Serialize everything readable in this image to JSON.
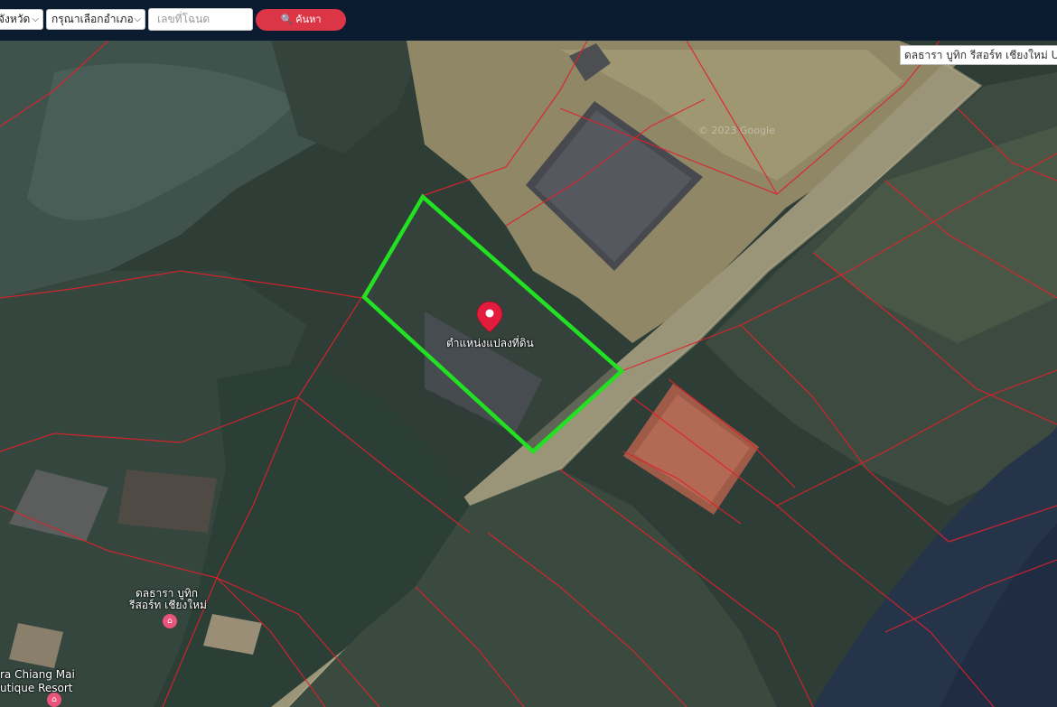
{
  "search": {
    "province_label": "จังหวัด",
    "district_label": "กรุณาเลือกอำเภอ",
    "deed_placeholder": "เลขที่โฉนด",
    "search_label": "ค้นหา"
  },
  "map": {
    "place_name": "ดลธารา บูทิก รีสอร์ท เชียงใหม่ Ur",
    "watermark": "© 2023 Google",
    "parcel_label": "ตำแหน่งแปลงที่ดิน",
    "poi_1_line1": "ดลธารา บูทิก",
    "poi_1_line2": "รีสอร์ท เชียงใหม่",
    "poi_2_line1": "ra Chiang Mai",
    "poi_2_line2": "utique Resort",
    "colors": {
      "parcel_outline": "#22e022",
      "boundary_lines": "#e0212b",
      "marker": "#e31b3c",
      "search_button": "#dc3545"
    }
  }
}
